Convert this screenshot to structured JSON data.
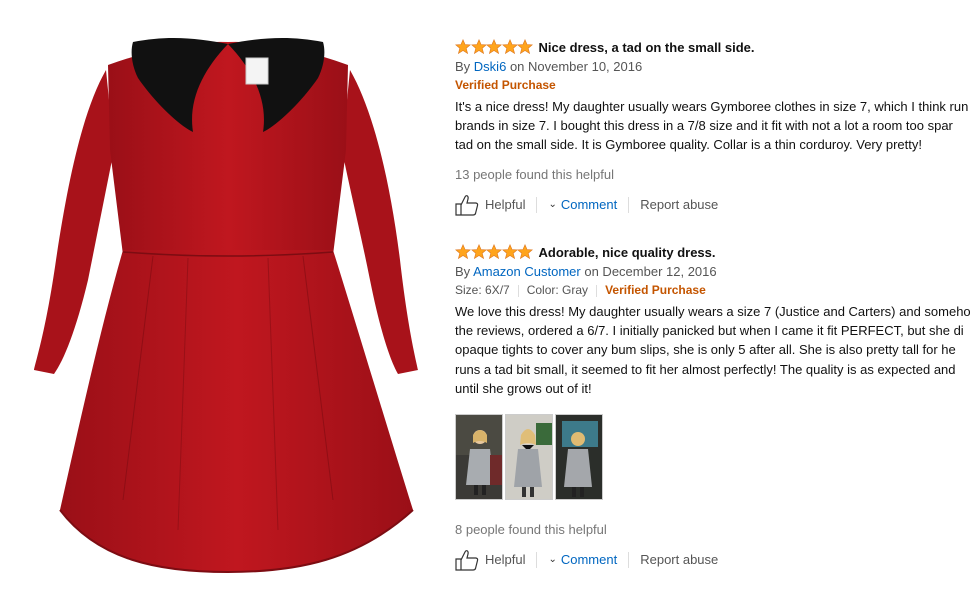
{
  "product": {
    "image_name": "red-dress-with-black-collar",
    "colors": {
      "dress": "#b3141c",
      "collar": "#111111"
    }
  },
  "colors": {
    "star": "#ffa41c",
    "link": "#0066c0",
    "verified": "#c45500"
  },
  "reviews": [
    {
      "rating": 5,
      "title": "Nice dress, a tad on the small side.",
      "by": "By",
      "author": "Dski6",
      "date": "on November 10, 2016",
      "verified": "Verified Purchase",
      "body": [
        "It's a nice dress! My daughter usually wears Gymboree clothes in size 7, which I think run",
        "brands in size 7. I bought this dress in a 7/8 size and it fit with not a lot a room too spar",
        "tad on the small side. It is Gymboree quality. Collar is a thin corduroy. Very pretty!"
      ],
      "helpful_count": "13 people found this helpful",
      "helpful_label": "Helpful",
      "comment_label": "Comment",
      "report_label": "Report abuse"
    },
    {
      "rating": 5,
      "title": "Adorable, nice quality dress.",
      "by": "By",
      "author": "Amazon Customer",
      "date": "on December 12, 2016",
      "size": "Size: 6X/7",
      "color": "Color: Gray",
      "verified": "Verified Purchase",
      "body": [
        "We love this dress! My daughter usually wears a size 7 (Justice and Carters) and someho",
        "the reviews, ordered a 6/7. I initially panicked but when I came it fit PERFECT, but she di",
        "opaque tights to cover any bum slips, she is only 5 after all. She is also pretty tall for he",
        "runs a tad bit small, it seemed to fit her almost perfectly! The quality is as expected and",
        "until she grows out of it!"
      ],
      "images": [
        "customer-photo-front",
        "customer-photo-smiling",
        "customer-photo-back"
      ],
      "helpful_count": "8 people found this helpful",
      "helpful_label": "Helpful",
      "comment_label": "Comment",
      "report_label": "Report abuse"
    }
  ]
}
